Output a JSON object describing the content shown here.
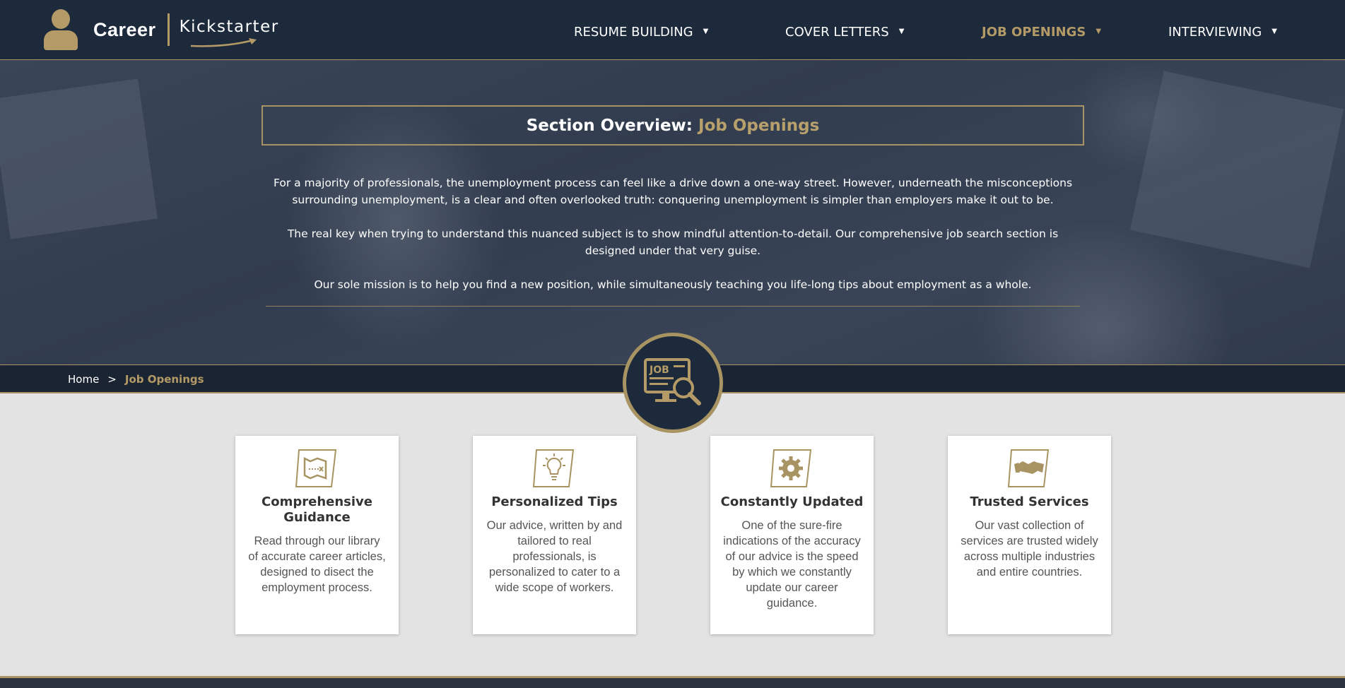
{
  "brand": {
    "name_bold": "Career",
    "name_light": "Kickstarter"
  },
  "nav": {
    "items": [
      {
        "label": "RESUME BUILDING"
      },
      {
        "label": "COVER LETTERS"
      },
      {
        "label": "JOB OPENINGS"
      },
      {
        "label": "INTERVIEWING"
      }
    ],
    "caret": "▼"
  },
  "overview": {
    "title_prefix": "Section Overview:",
    "title_accent": "Job Openings",
    "paragraphs": [
      "For a majority of professionals, the unemployment process can feel like a drive down a one-way street. However, underneath the misconceptions surrounding unemployment, is a clear and often overlooked truth: conquering unemployment is simpler than employers make it out to be.",
      "The real key when trying to understand this nuanced subject is to show mindful attention-to-detail. Our comprehensive job search section is designed under that very guise.",
      "Our sole mission is to help you find a new position, while simultaneously teaching you life-long tips about employment as a whole."
    ]
  },
  "breadcrumb": {
    "home": "Home",
    "separator": ">",
    "current": "Job Openings"
  },
  "badge": {
    "label": "JOB"
  },
  "cards": [
    {
      "icon": "map-icon",
      "title": "Comprehensive Guidance",
      "text": "Read through our library of accurate career articles, designed to disect the employment process."
    },
    {
      "icon": "lightbulb-icon",
      "title": "Personalized Tips",
      "text": "Our advice, written by and tailored to real professionals, is personalized to cater to a wide scope of workers."
    },
    {
      "icon": "gear-icon",
      "title": "Constantly Updated",
      "text": "One of the sure-fire indications of the accuracy of our advice is the speed by which we constantly update our career guidance."
    },
    {
      "icon": "handshake-icon",
      "title": "Trusted Services",
      "text": "Our vast collection of services are trusted widely across multiple industries and entire countries."
    }
  ],
  "colors": {
    "navy": "#1c2a3b",
    "gold": "#b49a66",
    "background": "#e3e3e3"
  }
}
